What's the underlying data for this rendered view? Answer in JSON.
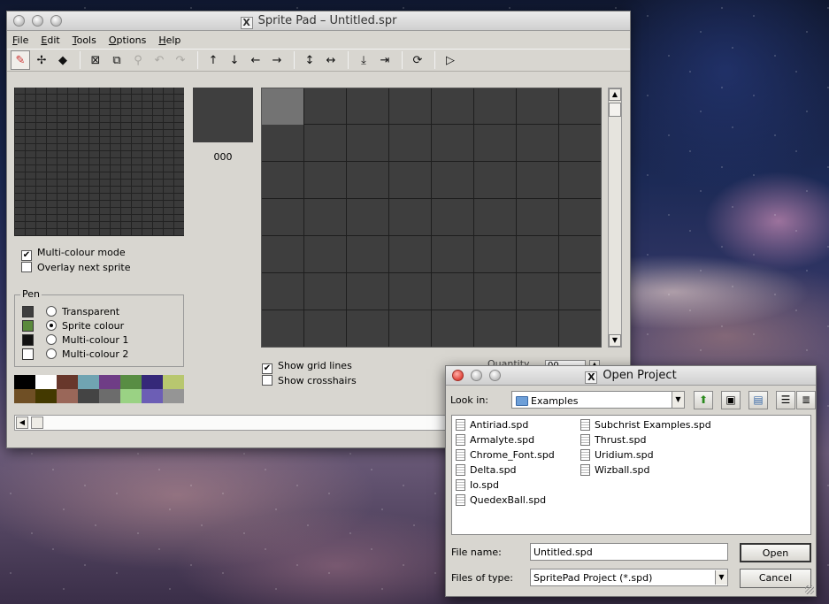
{
  "main": {
    "title": "Sprite Pad – Untitled.spr",
    "menu": [
      "File",
      "Edit",
      "Tools",
      "Options",
      "Help"
    ],
    "toolbar_icons": [
      "pencil-icon",
      "move-pixels-icon",
      "fill-bucket-icon",
      "clear-icon",
      "select-icon",
      "eyedropper-icon",
      "undo-icon",
      "redo-icon",
      "shift-up-icon",
      "shift-down-icon",
      "shift-left-icon",
      "shift-right-icon",
      "flip-vertical-icon",
      "flip-horizontal-icon",
      "stretch-down-icon",
      "stretch-right-icon",
      "rotate-icon",
      "play-icon"
    ],
    "swatch_code": "000",
    "multicolour_label": "Multi-colour mode",
    "multicolour_checked": true,
    "overlay_label": "Overlay next sprite",
    "overlay_checked": false,
    "pen": {
      "legend": "Pen",
      "options": [
        {
          "label": "Transparent",
          "color": "#3e3e3e",
          "selected": false
        },
        {
          "label": "Sprite colour",
          "color": "#5a8a3c",
          "selected": true
        },
        {
          "label": "Multi-colour 1",
          "color": "#111111",
          "selected": false
        },
        {
          "label": "Multi-colour 2",
          "color": "#ffffff",
          "selected": false
        }
      ]
    },
    "palette": [
      "#000000",
      "#ffffff",
      "#68372b",
      "#70a4b2",
      "#6f3d86",
      "#588d43",
      "#352879",
      "#b8c76f",
      "#6f4f25",
      "#433900",
      "#9a6759",
      "#444444",
      "#6c6c6c",
      "#9ad284",
      "#6c5eb5",
      "#959595"
    ],
    "show_grid_label": "Show grid lines",
    "show_grid_checked": true,
    "show_crosshairs_label": "Show crosshairs",
    "show_crosshairs_checked": false,
    "quantity_label": "Quantity",
    "quantity_value": "00"
  },
  "dialog": {
    "title": "Open Project",
    "look_in_label": "Look in:",
    "look_in_value": "Examples",
    "files_col1": [
      "Antiriad.spd",
      "Armalyte.spd",
      "Chrome_Font.spd",
      "Delta.spd",
      "Io.spd",
      "QuedexBall.spd"
    ],
    "files_col2": [
      "Subchrist Examples.spd",
      "Thrust.spd",
      "Uridium.spd",
      "Wizball.spd"
    ],
    "file_name_label": "File name:",
    "file_name_value": "Untitled.spd",
    "files_of_type_label": "Files of type:",
    "files_of_type_value": "SpritePad Project (*.spd)",
    "open_label": "Open",
    "cancel_label": "Cancel"
  }
}
